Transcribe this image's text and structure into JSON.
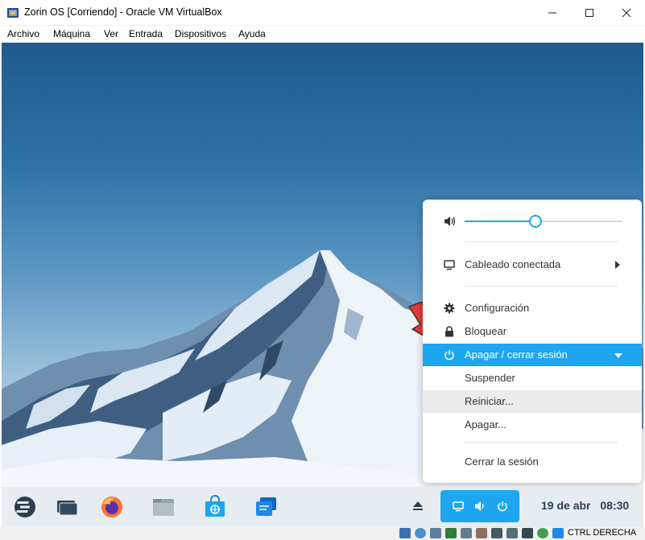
{
  "window": {
    "title": "Zorin OS [Corriendo] - Oracle VM VirtualBox",
    "minimize": "—",
    "maximize": "☐",
    "close": "✕"
  },
  "menubar": [
    "Archivo",
    "Máquina",
    "Ver",
    "Entrada",
    "Dispositivos",
    "Ayuda"
  ],
  "popup": {
    "volume_level": 0.45,
    "network_label": "Cableado conectada",
    "settings_label": "Configuración",
    "lock_label": "Bloquear",
    "power_label": "Apagar / cerrar sesión",
    "suspend_label": "Suspender",
    "restart_label": "Reiniciar...",
    "shutdown_label": "Apagar...",
    "logout_label": "Cerrar la sesión"
  },
  "taskbar": {
    "date": "19 de abr",
    "time": "08:30"
  },
  "statusbar": {
    "host_key": "CTRL DERECHA"
  },
  "colors": {
    "accent": "#1ea6f0",
    "arrow": "#e53935"
  }
}
